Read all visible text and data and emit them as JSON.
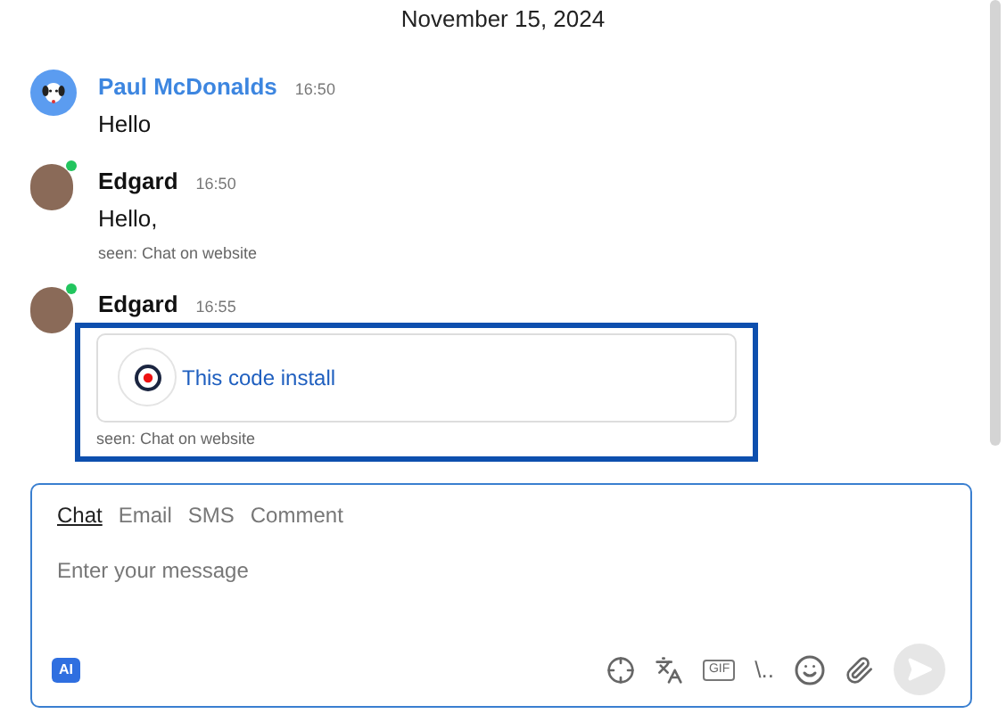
{
  "date_divider": "November 15, 2024",
  "messages": [
    {
      "kind": "text",
      "is_agent": true,
      "author": "Paul McDonalds",
      "online": false,
      "time": "16:50",
      "text": "Hello"
    },
    {
      "kind": "text",
      "is_agent": false,
      "author": "Edgard",
      "online": true,
      "time": "16:50",
      "text": "Hello,",
      "seen": "seen: Chat on website"
    },
    {
      "kind": "card",
      "is_agent": false,
      "author": "Edgard",
      "online": true,
      "time": "16:55",
      "text": "This code install",
      "seen": "seen: Chat on website",
      "highlighted": true
    }
  ],
  "composer": {
    "tabs": [
      {
        "label": "Chat",
        "selected": true
      },
      {
        "label": "Email",
        "selected": false
      },
      {
        "label": "SMS",
        "selected": false
      },
      {
        "label": "Comment",
        "selected": false
      }
    ],
    "placeholder": "Enter your message",
    "ai_badge": "AI",
    "gif_label": "GIF",
    "shortcut_label": "\\..",
    "send_disabled": true
  }
}
